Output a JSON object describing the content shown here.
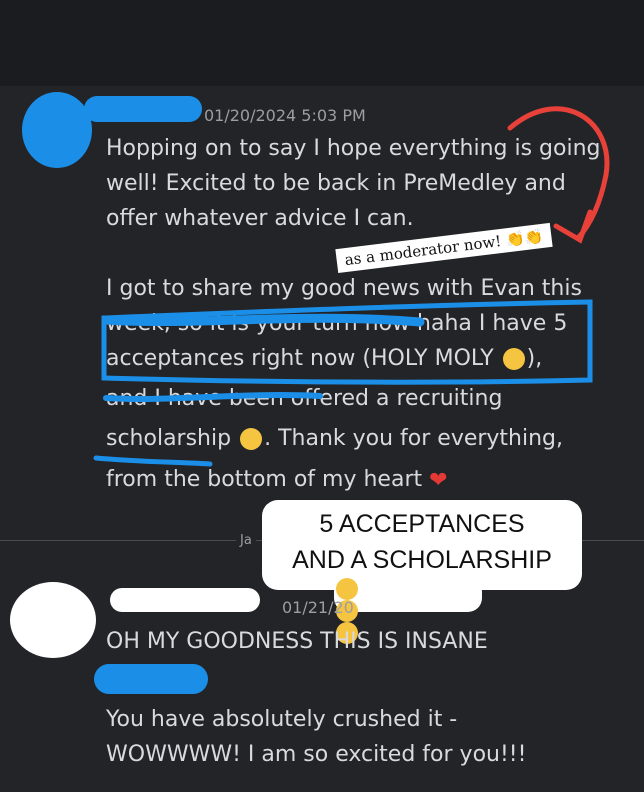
{
  "post1": {
    "timestamp": "01/20/2024 5:03 PM",
    "lines": [
      "Hopping on to say I hope everything is going",
      "well! Excited to be back in PreMedley and",
      "offer whatever advice I can.",
      "I got to share my good news with Evan this",
      "week, so it is your turn now haha I have 5",
      "acceptances right now (HOLY MOLY",
      "and I have been offered a recruiting",
      "scholarship",
      ". Thank you for everything,",
      "from the bottom of my heart"
    ],
    "sticker": "as a moderator now!"
  },
  "divider": {
    "label": "Ja"
  },
  "overlay_caption": {
    "line1": "5 ACCEPTANCES",
    "line2": "AND A SCHOLARSHIP"
  },
  "post2": {
    "timestamp": "01/21/20",
    "lines": [
      "OH MY GOODNESS THIS IS INSANE",
      "You have absolutely crushed it -",
      "WOWWWW! I am so excited for you!!!"
    ]
  },
  "colors": {
    "accent_blue": "#1b8fe8",
    "annotation_red": "#e8413a",
    "background": "#232428"
  }
}
